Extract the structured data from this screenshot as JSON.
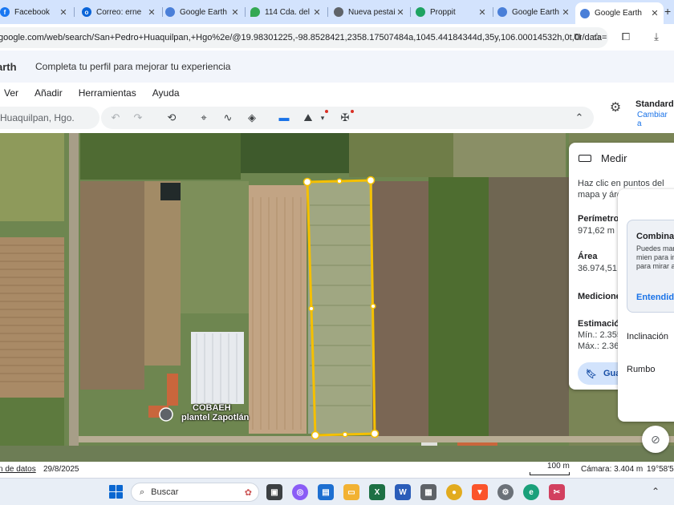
{
  "browser": {
    "tabs": [
      {
        "title": "Facebook",
        "icon": "facebook-icon",
        "color": "#1877f2"
      },
      {
        "title": "Correo: erne",
        "icon": "outlook-icon",
        "color": "#0a64d8"
      },
      {
        "title": "Google Earth",
        "icon": "google-earth-icon",
        "color": "#4a7fd8"
      },
      {
        "title": "114 Cda. del",
        "icon": "google-maps-icon",
        "color": "#34a853"
      },
      {
        "title": "Nueva pestaí",
        "icon": "chrome-icon",
        "color": "#5f6368"
      },
      {
        "title": "Proppit",
        "icon": "proppit-icon",
        "color": "#1ea362"
      },
      {
        "title": "Google Earth",
        "icon": "google-earth-icon",
        "color": "#4a7fd8"
      },
      {
        "title": "Google Earth",
        "icon": "google-earth-icon",
        "color": "#4a7fd8",
        "active": true
      }
    ],
    "new_tab_glyph": "+",
    "url": "google.com/web/search/San+Pedro+Huaquilpan,+Hgo%2e/@19.98301225,-98.8528421,2358.17507484a,1045.44184344d,35y,106.00014532h,0t,0r/data="
  },
  "earth": {
    "brand": "arth",
    "banner_message": "Completa tu perfil para mejorar tu experiencia",
    "menu": [
      "Ver",
      "Añadir",
      "Herramientas",
      "Ayuda"
    ],
    "search_value": "Huaquilpan, Hgo.",
    "map_style_title": "Standard",
    "map_style_link": "Cambiar a"
  },
  "map": {
    "label_line1": "COBAEH",
    "label_line2": "plantel Zapotlán"
  },
  "measure": {
    "title": "Medir",
    "instructions": "Haz clic en puntos del mapa y áreas",
    "perimeter_label": "Perímetro",
    "perimeter_value": "971,62 m",
    "area_label": "Área",
    "area_value": "36.974,51 m",
    "measurements_label": "Mediciones",
    "estimation_label": "Estimación",
    "min_value": "Mín.: 2.355",
    "max_value": "Máx.: 2.362",
    "save_label": "Guar"
  },
  "tooltip": {
    "title": "Combinac",
    "body": "Puedes mar Mayús mien para inclina para mirar a",
    "action": "Entendid",
    "tilt_label": "Inclinación",
    "heading_label": "Rumbo"
  },
  "status": {
    "data_source": "n de datos",
    "date": "29/8/2025",
    "scale": "100 m",
    "camera": "Cámara: 3.404 m",
    "coordinates": "19°58'51"
  },
  "taskbar": {
    "search_placeholder": "Buscar",
    "apps": [
      "task-view-icon",
      "copilot-icon",
      "store-icon",
      "file-explorer-icon",
      "excel-icon",
      "word-icon",
      "calculator-icon",
      "chrome-icon",
      "brave-icon",
      "settings-icon",
      "edge-icon",
      "snipping-tool-icon"
    ]
  },
  "colors": {
    "measure_outline": "#f5c000",
    "link_blue": "#1a73e8",
    "tab_strip": "#d3e3fd"
  }
}
